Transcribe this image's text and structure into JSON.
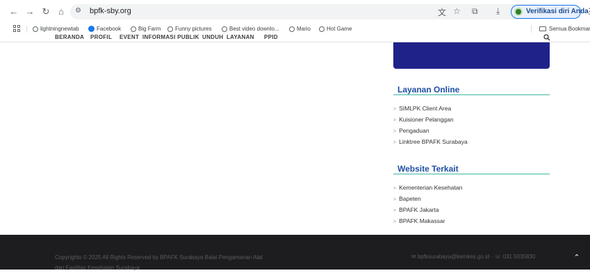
{
  "browser": {
    "url": "bpfk-sby.org",
    "verify_label": "Verifikasi diri Anda",
    "icons": [
      "back-icon",
      "forward-icon",
      "reload-icon",
      "home-icon",
      "site-info-icon",
      "translate-icon",
      "star-icon",
      "extensions-icon",
      "download-icon",
      "kebab-icon"
    ]
  },
  "bookmarks": {
    "items": [
      "lightningnewtab",
      "Facebook",
      "Big Farm",
      "Funny pictures",
      "Best video downlo...",
      "Mario",
      "Hot Game"
    ],
    "all_bookmarks": "Semua Bookmark"
  },
  "site_nav": {
    "items": [
      "BERANDA",
      "PROFIL",
      "EVENT",
      "INFORMASI PUBLIK",
      "UNDUH",
      "LAYANAN",
      "PPID"
    ]
  },
  "sidebar": {
    "layanan_title": "Layanan Online",
    "layanan_links": [
      "SIMLPK Client Area",
      "Kuisioner Pelanggan",
      "Pengaduan",
      "Linktree BPAFK Surabaya"
    ],
    "website_title": "Website Terkait",
    "website_links": [
      "Kementerian Kesehatan",
      "Bapeten",
      "BPAFK Jakarta",
      "BPAFK Makassar"
    ]
  },
  "footer": {
    "copyright_line1": "Copyrights © 2025 All Rights Reserved by BPAFK Surabaya Balai Pengamanan Alat",
    "copyright_line2": "dan Fasilitas Kesehatan Surabaya",
    "email": "bpfksurabaya@kemkes.go.id",
    "phone": "031 5035830"
  },
  "colors": {
    "primary_blue": "#1f2389",
    "heading_blue": "#1e4fa5",
    "accent_teal": "#3cb7a4",
    "footer_bg": "#1d1d1f"
  }
}
